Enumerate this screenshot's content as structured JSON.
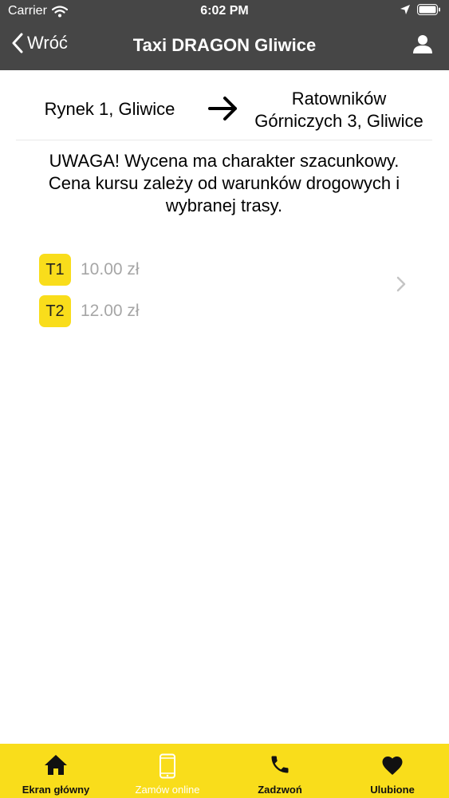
{
  "status_bar": {
    "carrier": "Carrier",
    "time": "6:02 PM"
  },
  "nav": {
    "back_label": "Wróć",
    "title": "Taxi DRAGON Gliwice"
  },
  "route": {
    "from": "Rynek 1, Gliwice",
    "to_line1": "Ratowników",
    "to_line2": "Górniczych 3, Gliwice"
  },
  "notice": {
    "line1": "UWAGA! Wycena ma charakter szacunkowy.",
    "line2": "Cena kursu zależy od warunków drogowych i",
    "line3": "wybranej trasy."
  },
  "prices": [
    {
      "tariff": "T1",
      "amount": "10.00 zł"
    },
    {
      "tariff": "T2",
      "amount": "12.00 zł"
    }
  ],
  "tabs": [
    {
      "label": "Ekran główny",
      "icon": "home-icon"
    },
    {
      "label": "Zamów online",
      "icon": "phone-device-icon"
    },
    {
      "label": "Zadzwoń",
      "icon": "call-icon"
    },
    {
      "label": "Ulubione",
      "icon": "heart-icon"
    }
  ],
  "colors": {
    "header": "#464646",
    "accent_yellow": "#f9dd1b",
    "price_gray": "#a6a6a6"
  }
}
